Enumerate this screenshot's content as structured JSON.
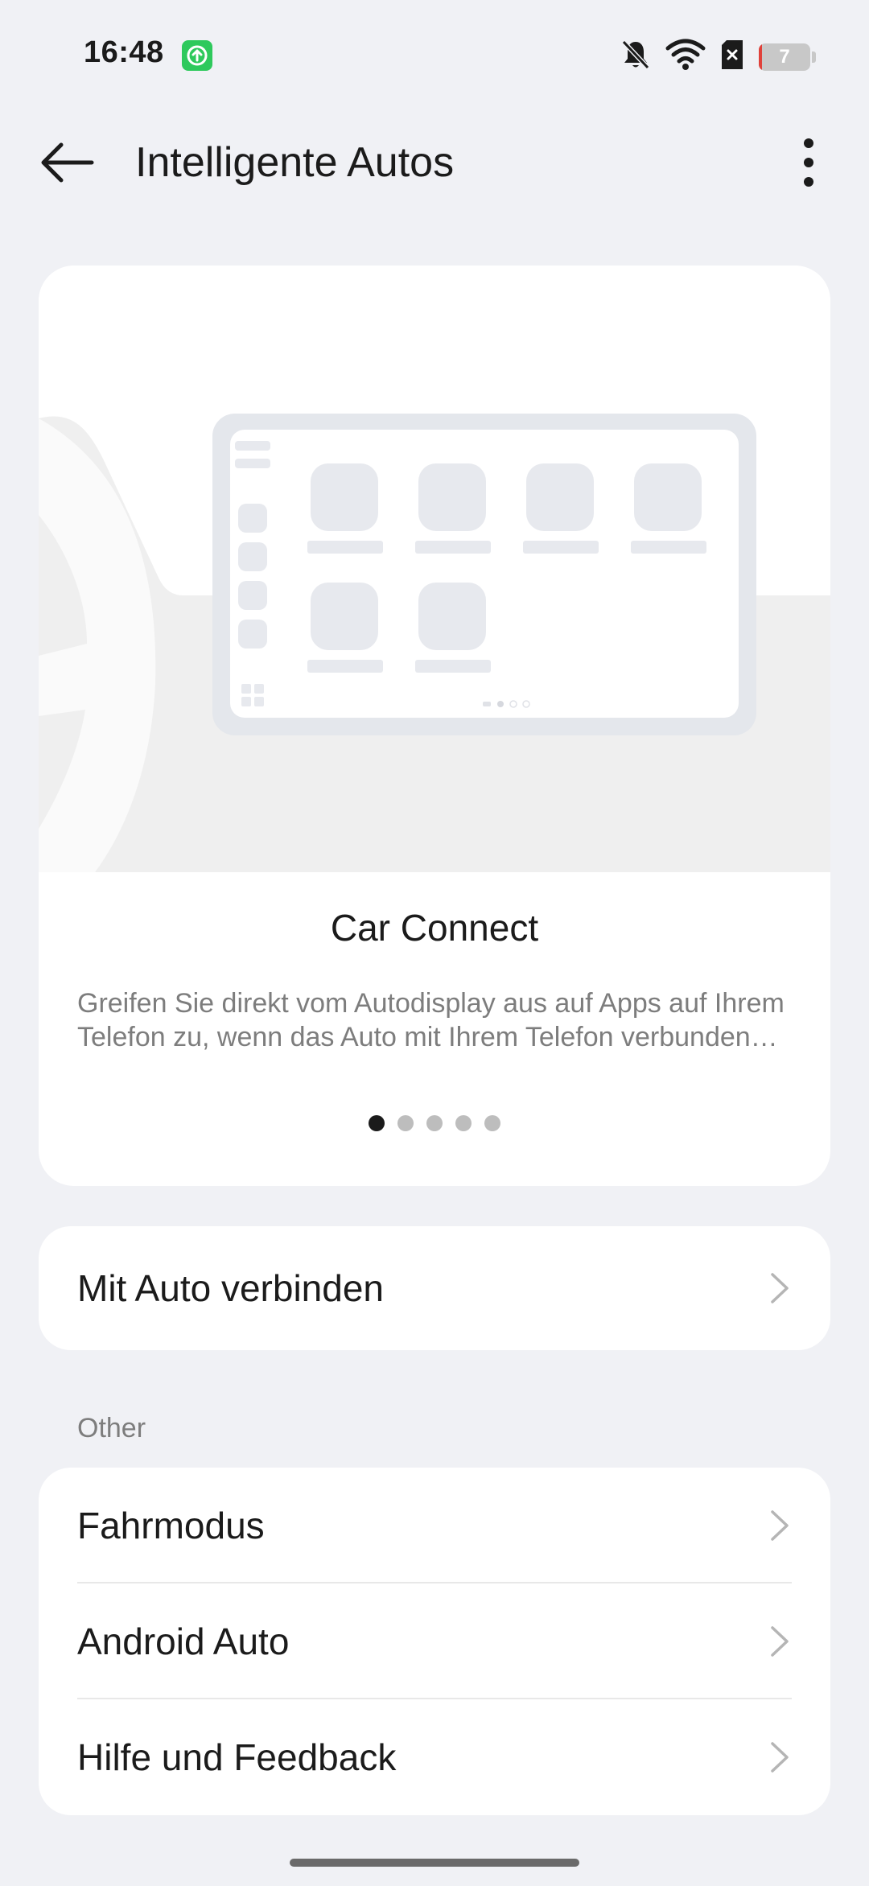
{
  "status_bar": {
    "time": "16:48",
    "battery_level": "7",
    "battery_fraction": 0.07,
    "icons": [
      "upload-app-icon",
      "bell-off-icon",
      "wifi-icon",
      "sim-error-icon",
      "battery-icon"
    ]
  },
  "header": {
    "title": "Intelligente Autos",
    "back_icon": "arrow-left-icon",
    "more_icon": "more-vertical-icon"
  },
  "hero": {
    "title": "Car Connect",
    "description": "Greifen Sie direkt vom Autodisplay aus auf Apps auf Ihrem Telefon zu, wenn das Auto mit Ihrem Telefon verbunden ist.",
    "pages": 5,
    "active_page": 1
  },
  "connect": {
    "label": "Mit Auto verbinden"
  },
  "other": {
    "header": "Other",
    "items": [
      {
        "label": "Fahrmodus"
      },
      {
        "label": "Android Auto"
      },
      {
        "label": "Hilfe und Feedback"
      }
    ]
  },
  "colors": {
    "background": "#f0f1f5",
    "card": "#ffffff",
    "text_primary": "#1b1b1b",
    "text_secondary": "#7d7d7d",
    "status_app_green": "#2ec95c",
    "battery_low": "#e0413a"
  }
}
